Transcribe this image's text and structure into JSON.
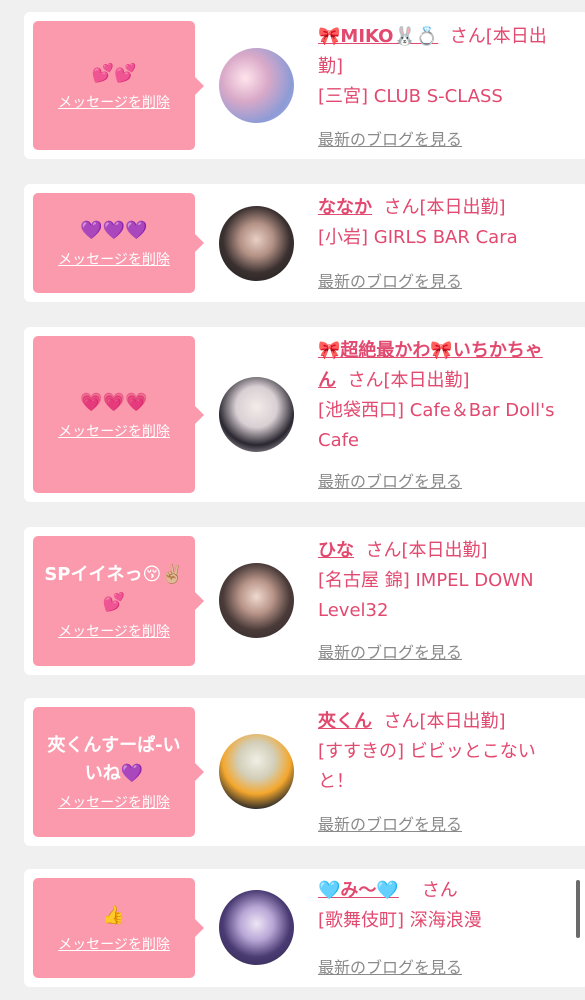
{
  "delete_label": "メッセージを削除",
  "blog_label": "最新のブログを見る",
  "honorific": "さん",
  "colors": {
    "bubble": "#fb9aad",
    "accent": "#e2496f",
    "link_gray": "#8a8a8a",
    "background": "#f0f0f0"
  },
  "cards": [
    {
      "message": "💕💕",
      "name": "🎀MIKO🐰💍",
      "status": "[本日出勤]",
      "shop": "[三宮] CLUB S-CLASS"
    },
    {
      "message": "💜💜💜",
      "name": "ななか",
      "status": "[本日出勤]",
      "shop": "[小岩] GIRLS BAR Cara"
    },
    {
      "message": "💗💗💗",
      "name": "🎀超絶最かわ🎀いちかちゃん",
      "status": "[本日出勤]",
      "shop": "[池袋西口] Cafe＆Bar Doll's Cafe"
    },
    {
      "message": "SPイイネっ😚✌🏼💕",
      "name": "ひな",
      "status": "[本日出勤]",
      "shop": "[名古屋 錦] IMPEL DOWN Level32"
    },
    {
      "message": "夾くんすーぱ-いいね💜",
      "name": "夾くん",
      "status": "[本日出勤]",
      "shop": "[すすきの] ビビッとこないと！"
    },
    {
      "message": "👍",
      "name": "🩵み〜🩵",
      "status": "",
      "shop": "[歌舞伎町] 深海浪漫"
    }
  ]
}
